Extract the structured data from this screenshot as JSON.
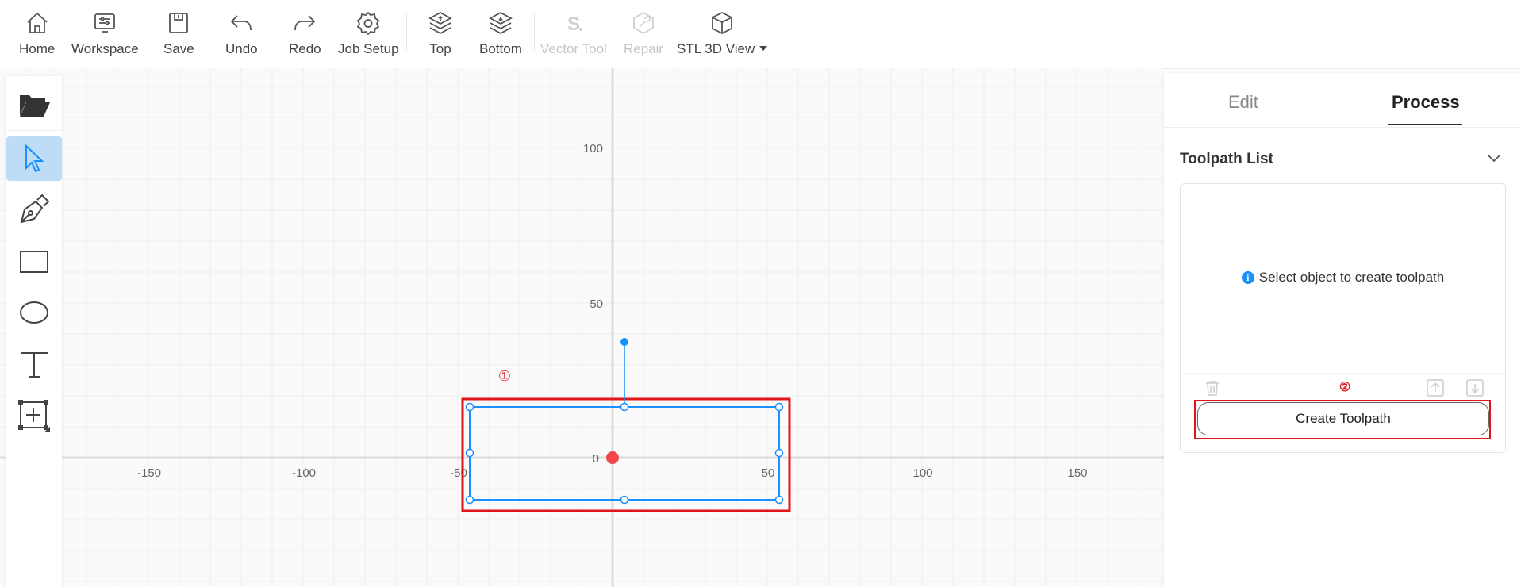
{
  "toolbar": {
    "items": [
      {
        "label": "Home",
        "icon": "home-icon",
        "enabled": true
      },
      {
        "label": "Workspace",
        "icon": "workspace-icon",
        "enabled": true
      },
      {
        "label": "Save",
        "icon": "save-icon",
        "enabled": true
      },
      {
        "label": "Undo",
        "icon": "undo-icon",
        "enabled": true
      },
      {
        "label": "Redo",
        "icon": "redo-icon",
        "enabled": true
      },
      {
        "label": "Job Setup",
        "icon": "gear-icon",
        "enabled": true
      },
      {
        "label": "Top",
        "icon": "layers-up-icon",
        "enabled": true
      },
      {
        "label": "Bottom",
        "icon": "layers-down-icon",
        "enabled": true
      },
      {
        "label": "Vector Tool",
        "icon": "vector-tool-icon",
        "enabled": false
      },
      {
        "label": "Repair",
        "icon": "repair-icon",
        "enabled": false
      },
      {
        "label": "STL 3D View",
        "icon": "cube-icon",
        "enabled": true,
        "dropdown": true
      }
    ]
  },
  "left_tools": [
    {
      "name": "open-file",
      "icon": "folder-icon",
      "active": false
    },
    {
      "name": "select",
      "icon": "cursor-icon",
      "active": true
    },
    {
      "name": "pen",
      "icon": "pen-icon",
      "active": false
    },
    {
      "name": "rectangle",
      "icon": "rectangle-icon",
      "active": false
    },
    {
      "name": "ellipse",
      "icon": "ellipse-icon",
      "active": false
    },
    {
      "name": "text",
      "icon": "text-icon",
      "active": false
    },
    {
      "name": "insert",
      "icon": "insert-box-icon",
      "active": false
    }
  ],
  "canvas": {
    "x_ticks": [
      "-150",
      "-100",
      "-50",
      "50",
      "100",
      "150"
    ],
    "y_ticks": [
      "100",
      "50",
      "0"
    ],
    "selection_color": "#1890ff",
    "origin_color": "#f0474b",
    "annotation_color": "#e0151a",
    "annotation_1": "①"
  },
  "panel": {
    "tabs": [
      {
        "label": "Edit",
        "active": false
      },
      {
        "label": "Process",
        "active": true
      }
    ],
    "section_title": "Toolpath List",
    "empty_message": "Select object to create toolpath",
    "info_icon_glyph": "i",
    "create_button": "Create Toolpath",
    "annotation_2": "②"
  }
}
